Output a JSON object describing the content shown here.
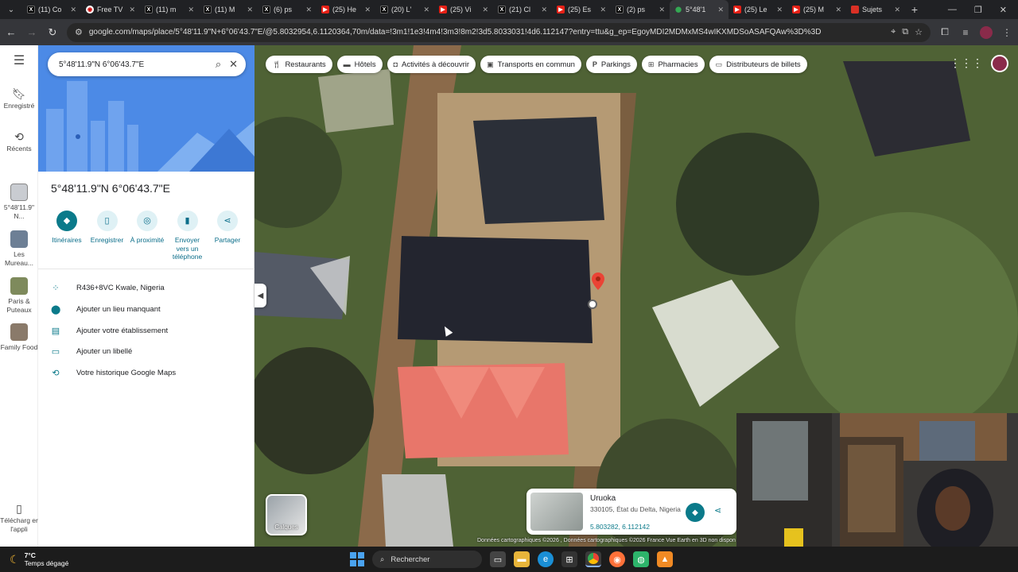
{
  "browser": {
    "tabs": [
      {
        "label": "(11) Co",
        "icon": "x-logo-icon"
      },
      {
        "label": "Free TV",
        "icon": "free-tv-icon"
      },
      {
        "label": "(11) m",
        "icon": "x-logo-icon"
      },
      {
        "label": "(11) M",
        "icon": "x-logo-icon"
      },
      {
        "label": "(6) ps",
        "icon": "x-logo-icon"
      },
      {
        "label": "(25) He",
        "icon": "youtube-icon"
      },
      {
        "label": "(20) L'",
        "icon": "x-logo-icon"
      },
      {
        "label": "(25) Vi",
        "icon": "youtube-icon"
      },
      {
        "label": "(21) Cl",
        "icon": "x-logo-icon"
      },
      {
        "label": "(25) Es",
        "icon": "youtube-icon"
      },
      {
        "label": "(2) ps",
        "icon": "x-logo-icon"
      },
      {
        "label": "5°48'1",
        "icon": "maps-icon",
        "active": true
      },
      {
        "label": "(25) Le",
        "icon": "youtube-icon"
      },
      {
        "label": "(25) M",
        "icon": "youtube-icon"
      },
      {
        "label": "Sujets",
        "icon": "red-square-icon"
      }
    ],
    "url": "google.com/maps/place/5°48'11.9\"N+6°06'43.7\"E/@5.8032954,6.1120364,70m/data=!3m1!1e3!4m4!3m3!8m2!3d5.8033031!4d6.112147?entry=ttu&g_ep=EgoyMDI2MDMxMS4wIKXMDSoASAFQAw%3D%3D"
  },
  "maps": {
    "rail": [
      {
        "label": "Enregistré",
        "icon": "bookmark-icon"
      },
      {
        "label": "Récents",
        "icon": "history-icon"
      },
      {
        "label": "5°48'11.9\" N...",
        "icon": "place-thumbnail"
      },
      {
        "label": "Les Mureau...",
        "icon": "place-thumbnail"
      },
      {
        "label": "Paris & Puteaux",
        "icon": "place-thumbnail"
      },
      {
        "label": "Family Food",
        "icon": "place-thumbnail"
      },
      {
        "label": "Télécharg er l'appli",
        "icon": "phone-icon"
      }
    ],
    "search": {
      "query": "5°48'11.9\"N 6°06'43.7\"E"
    },
    "place_title": "5°48'11.9\"N 6°06'43.7\"E",
    "actions": [
      {
        "label": "Itinéraires",
        "icon": "directions-icon"
      },
      {
        "label": "Enregistrer",
        "icon": "bookmark-icon"
      },
      {
        "label": "À proximité",
        "icon": "nearby-icon"
      },
      {
        "label": "Envoyer vers un téléphone",
        "icon": "send-to-phone-icon"
      },
      {
        "label": "Partager",
        "icon": "share-icon"
      }
    ],
    "info_rows": [
      {
        "label": "R436+8VC Kwale, Nigeria",
        "icon": "plus-code-icon"
      },
      {
        "label": "Ajouter un lieu manquant",
        "icon": "add-place-icon"
      },
      {
        "label": "Ajouter votre établissement",
        "icon": "business-icon"
      },
      {
        "label": "Ajouter un libellé",
        "icon": "label-icon"
      },
      {
        "label": "Votre historique Google Maps",
        "icon": "history-icon"
      }
    ],
    "chips": [
      {
        "label": "Restaurants",
        "icon": "restaurant-icon"
      },
      {
        "label": "Hôtels",
        "icon": "hotel-icon"
      },
      {
        "label": "Activités à découvrir",
        "icon": "camera-icon"
      },
      {
        "label": "Transports en commun",
        "icon": "transit-icon"
      },
      {
        "label": "Parkings",
        "icon": "parking-icon"
      },
      {
        "label": "Pharmacies",
        "icon": "pharmacy-icon"
      },
      {
        "label": "Distributeurs de billets",
        "icon": "atm-icon"
      }
    ],
    "layers_label": "Calques",
    "place_card": {
      "name": "Uruoka",
      "address": "330105, État du Delta, Nigeria",
      "coords": "5.803282, 6.112142"
    },
    "attribution": "Données cartographiques ©2026 , Données cartographiques ©2026     France     Vue Earth en 3D non dispon"
  },
  "taskbar": {
    "weather_temp": "7°C",
    "weather_desc": "Temps dégagé",
    "search_placeholder": "Rechercher"
  }
}
